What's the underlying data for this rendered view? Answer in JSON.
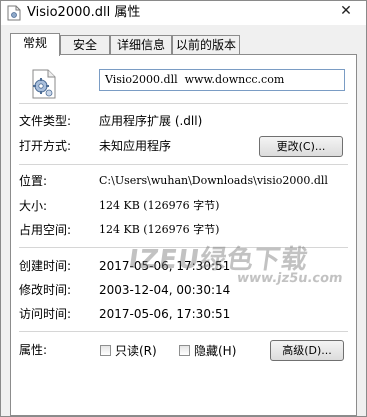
{
  "window": {
    "title": "Visio2000.dll 属性",
    "close_glyph": "✕"
  },
  "tabs": [
    {
      "label": "常规",
      "active": true
    },
    {
      "label": "安全",
      "active": false
    },
    {
      "label": "详细信息",
      "active": false
    },
    {
      "label": "以前的版本",
      "active": false
    }
  ],
  "general": {
    "file_icon": "dll-file-gear-icon",
    "file_name": "Visio2000.dll  www.downcc.com",
    "file_type_label": "文件类型:",
    "file_type_value": "应用程序扩展 (.dll)",
    "open_with_label": "打开方式:",
    "open_with_value": "未知应用程序",
    "change_button": "更改(C)...",
    "location_label": "位置:",
    "location_value": "C:\\Users\\wuhan\\Downloads\\visio2000.dll",
    "size_label": "大小:",
    "size_value": "124 KB (126976 字节)",
    "size_on_disk_label": "占用空间:",
    "size_on_disk_value": "124 KB (126976 字节)",
    "created_label": "创建时间:",
    "created_value": "2017-05-06, 17:30:51",
    "modified_label": "修改时间:",
    "modified_value": "2003-12-04, 00:30:14",
    "accessed_label": "访问时间:",
    "accessed_value": "2017-05-06, 17:30:51",
    "attributes_label": "属性:",
    "readonly_label": "只读(R)",
    "readonly_checked": false,
    "hidden_label": "隐藏(H)",
    "hidden_checked": false,
    "advanced_button": "高级(D)..."
  },
  "watermark": {
    "main": "IZEU绿色下载",
    "sub": "www.jz5u.com"
  },
  "colors": {
    "window_bg": "#f0f0f0",
    "panel_bg": "#ffffff",
    "border": "#8c8c8c",
    "input_border": "#7a9cc4"
  }
}
